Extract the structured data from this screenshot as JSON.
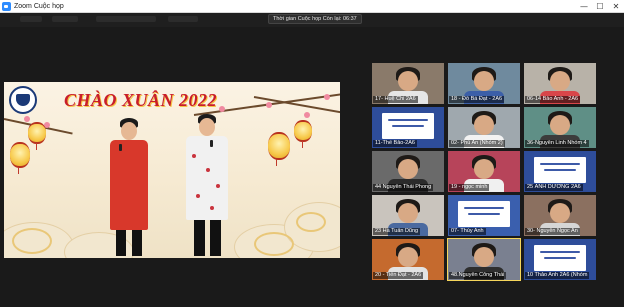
{
  "window": {
    "title": "Zoom Cuộc họp",
    "controls": {
      "minimize": "—",
      "maximize": "☐",
      "close": "✕"
    }
  },
  "meeting": {
    "timer_text": "Thời gian Cuộc họp Còn lại: 06:37"
  },
  "share_screen": {
    "banner_title": "CHÀO XUÂN 2022"
  },
  "colors": {
    "background": "#1a1a1a",
    "active_speaker_border": "#f6d65b",
    "banner_red": "#c81d2a",
    "slide_blue": "#2e4d9a"
  },
  "participants": [
    {
      "name": "17- Huệ Chi 2A6",
      "kind": "camera",
      "bg": "#8a7a6a",
      "shirt": "#e6e6e6",
      "active": false
    },
    {
      "name": "18 - Đỗ Bá Đạt - 2A6",
      "kind": "camera",
      "bg": "#6f8a9e",
      "shirt": "#3b5fa8",
      "active": false
    },
    {
      "name": "06-14 Bảo Anh - 2A6",
      "kind": "camera",
      "bg": "#b8b2a8",
      "shirt": "#d9464a",
      "active": false
    },
    {
      "name": "11-Thế Bảo-2A6",
      "kind": "slide",
      "bg": "#2e4d9a",
      "shirt": "",
      "active": false
    },
    {
      "name": "02- Phú An (Nhóm 2)",
      "kind": "camera",
      "bg": "#9fa8ae",
      "shirt": "#f2f2f2",
      "active": false
    },
    {
      "name": "36-Nguyễn Linh Nhóm 4",
      "kind": "camera",
      "bg": "#5f8f86",
      "shirt": "#3c3c3c",
      "active": false
    },
    {
      "name": "44 Nguyễn Thái Phong",
      "kind": "camera",
      "bg": "#6a6a6a",
      "shirt": "#2b2b2b",
      "active": false
    },
    {
      "name": "19 - ngọc minh",
      "kind": "camera",
      "bg": "#b7445a",
      "shirt": "#f0f0f0",
      "active": false
    },
    {
      "name": "25 ÁNH DƯƠNG 2A6",
      "kind": "slide",
      "bg": "#2e4d9a",
      "shirt": "",
      "active": false
    },
    {
      "name": "23 Hà Tuấn Dũng",
      "kind": "camera",
      "bg": "#c9c4bd",
      "shirt": "#4a6aa0",
      "active": false
    },
    {
      "name": "07- Thúy Anh",
      "kind": "slide",
      "bg": "#3a5fae",
      "shirt": "",
      "active": false
    },
    {
      "name": "30- Nguyễn Ngọc An",
      "kind": "camera",
      "bg": "#8b7060",
      "shirt": "#d6d6d6",
      "active": false
    },
    {
      "name": "20 - Tiến Đạt - 2A6",
      "kind": "camera",
      "bg": "#c56a2e",
      "shirt": "#e3e3e3",
      "active": false
    },
    {
      "name": "48.Nguyễn Công Thái",
      "kind": "camera",
      "bg": "#7a8090",
      "shirt": "#2e2e2e",
      "active": true
    },
    {
      "name": "10 Thảo Anh 2A6 (Nhóm",
      "kind": "slide",
      "bg": "#2e4d9a",
      "shirt": "",
      "active": false
    }
  ]
}
